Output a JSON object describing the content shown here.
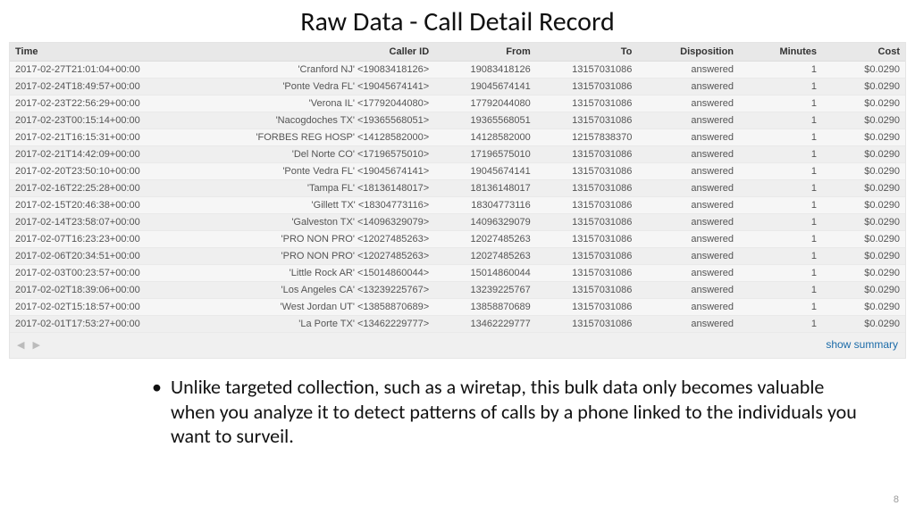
{
  "title": "Raw Data - Call Detail Record",
  "columns": {
    "time": "Time",
    "caller": "Caller ID",
    "from": "From",
    "to": "To",
    "disp": "Disposition",
    "min": "Minutes",
    "cost": "Cost"
  },
  "rows": [
    {
      "time": "2017-02-27T21:01:04+00:00",
      "caller": "'Cranford NJ' <19083418126>",
      "from": "19083418126",
      "to": "13157031086",
      "disp": "answered",
      "min": "1",
      "cost": "$0.0290"
    },
    {
      "time": "2017-02-24T18:49:57+00:00",
      "caller": "'Ponte Vedra FL' <19045674141>",
      "from": "19045674141",
      "to": "13157031086",
      "disp": "answered",
      "min": "1",
      "cost": "$0.0290"
    },
    {
      "time": "2017-02-23T22:56:29+00:00",
      "caller": "'Verona IL' <17792044080>",
      "from": "17792044080",
      "to": "13157031086",
      "disp": "answered",
      "min": "1",
      "cost": "$0.0290"
    },
    {
      "time": "2017-02-23T00:15:14+00:00",
      "caller": "'Nacogdoches TX' <19365568051>",
      "from": "19365568051",
      "to": "13157031086",
      "disp": "answered",
      "min": "1",
      "cost": "$0.0290"
    },
    {
      "time": "2017-02-21T16:15:31+00:00",
      "caller": "'FORBES REG HOSP' <14128582000>",
      "from": "14128582000",
      "to": "12157838370",
      "disp": "answered",
      "min": "1",
      "cost": "$0.0290"
    },
    {
      "time": "2017-02-21T14:42:09+00:00",
      "caller": "'Del Norte CO' <17196575010>",
      "from": "17196575010",
      "to": "13157031086",
      "disp": "answered",
      "min": "1",
      "cost": "$0.0290"
    },
    {
      "time": "2017-02-20T23:50:10+00:00",
      "caller": "'Ponte Vedra FL' <19045674141>",
      "from": "19045674141",
      "to": "13157031086",
      "disp": "answered",
      "min": "1",
      "cost": "$0.0290"
    },
    {
      "time": "2017-02-16T22:25:28+00:00",
      "caller": "'Tampa FL' <18136148017>",
      "from": "18136148017",
      "to": "13157031086",
      "disp": "answered",
      "min": "1",
      "cost": "$0.0290"
    },
    {
      "time": "2017-02-15T20:46:38+00:00",
      "caller": "'Gillett TX' <18304773116>",
      "from": "18304773116",
      "to": "13157031086",
      "disp": "answered",
      "min": "1",
      "cost": "$0.0290"
    },
    {
      "time": "2017-02-14T23:58:07+00:00",
      "caller": "'Galveston TX' <14096329079>",
      "from": "14096329079",
      "to": "13157031086",
      "disp": "answered",
      "min": "1",
      "cost": "$0.0290"
    },
    {
      "time": "2017-02-07T16:23:23+00:00",
      "caller": "'PRO NON PRO' <12027485263>",
      "from": "12027485263",
      "to": "13157031086",
      "disp": "answered",
      "min": "1",
      "cost": "$0.0290"
    },
    {
      "time": "2017-02-06T20:34:51+00:00",
      "caller": "'PRO NON PRO' <12027485263>",
      "from": "12027485263",
      "to": "13157031086",
      "disp": "answered",
      "min": "1",
      "cost": "$0.0290"
    },
    {
      "time": "2017-02-03T00:23:57+00:00",
      "caller": "'Little Rock AR' <15014860044>",
      "from": "15014860044",
      "to": "13157031086",
      "disp": "answered",
      "min": "1",
      "cost": "$0.0290"
    },
    {
      "time": "2017-02-02T18:39:06+00:00",
      "caller": "'Los Angeles CA' <13239225767>",
      "from": "13239225767",
      "to": "13157031086",
      "disp": "answered",
      "min": "1",
      "cost": "$0.0290"
    },
    {
      "time": "2017-02-02T15:18:57+00:00",
      "caller": "'West Jordan UT' <13858870689>",
      "from": "13858870689",
      "to": "13157031086",
      "disp": "answered",
      "min": "1",
      "cost": "$0.0290"
    },
    {
      "time": "2017-02-01T17:53:27+00:00",
      "caller": "'La Porte TX' <13462229777>",
      "from": "13462229777",
      "to": "13157031086",
      "disp": "answered",
      "min": "1",
      "cost": "$0.0290"
    }
  ],
  "footer": {
    "show_summary": "show summary",
    "arrow_left": "◀",
    "arrow_right": "▶"
  },
  "bullet_text": "Unlike targeted collection, such as a wiretap, this bulk data only becomes valuable when you analyze it to detect patterns of calls by a phone linked to the individuals you want to surveil.",
  "page_number": "8"
}
